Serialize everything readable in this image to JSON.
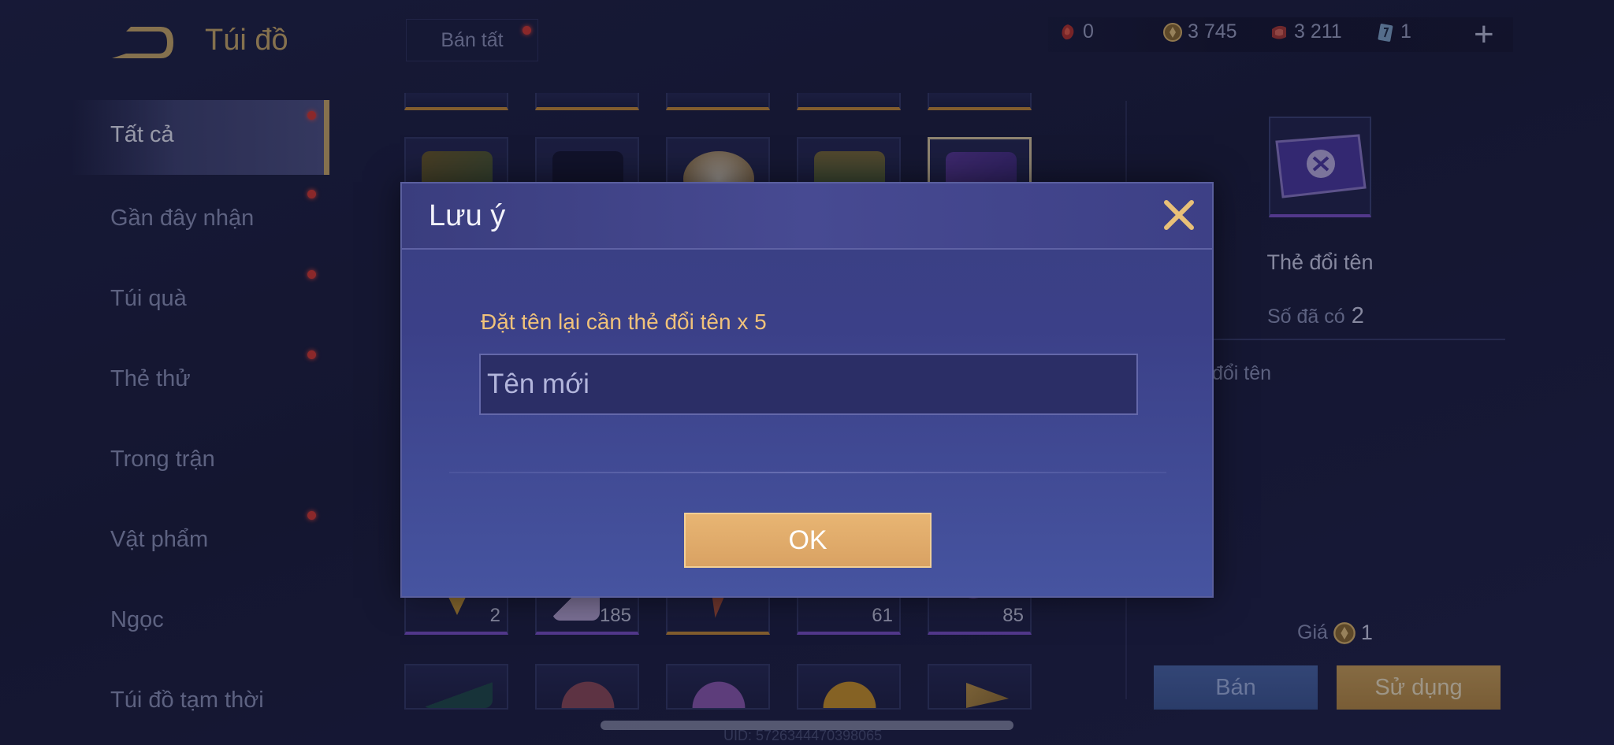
{
  "header": {
    "title": "Túi đồ",
    "sell_all_label": "Bán tất",
    "currencies": [
      {
        "icon": "red-gem-icon",
        "value": "0"
      },
      {
        "icon": "gold-coin-icon",
        "value": "3 745"
      },
      {
        "icon": "red-voucher-icon",
        "value": "3 211"
      },
      {
        "icon": "blue-card-icon",
        "value": "1"
      }
    ]
  },
  "sidebar": {
    "items": [
      {
        "label": "Tất cả",
        "active": true,
        "badge": true
      },
      {
        "label": "Gần đây nhận",
        "badge": true
      },
      {
        "label": "Túi quà",
        "badge": true
      },
      {
        "label": "Thẻ thử",
        "badge": true
      },
      {
        "label": "Trong trận",
        "badge": false
      },
      {
        "label": "Vật phẩm",
        "badge": true
      },
      {
        "label": "Ngọc",
        "badge": false
      },
      {
        "label": "Túi đồ tạm thời",
        "badge": false
      }
    ]
  },
  "grid": {
    "middle_row_quantities": [
      "2",
      "185",
      "",
      "61",
      "85"
    ]
  },
  "detail": {
    "name": "Thẻ đổi tên",
    "owned_label": "Số đã có",
    "owned_value": "2",
    "description_fragment": "đổi tên",
    "price_label": "Giá",
    "price_value": "1",
    "sell_label": "Bán",
    "use_label": "Sử dụng"
  },
  "footer": {
    "uid_text": "UID: 5726344470398065"
  },
  "modal": {
    "title": "Lưu ý",
    "message": "Đặt tên lại cần thẻ đổi tên x 5",
    "input_placeholder": "Tên mới",
    "ok_label": "OK"
  },
  "colors": {
    "accent_gold": "#c8a96a",
    "badge_red": "#d23a34",
    "message_text": "#f0c27a"
  }
}
